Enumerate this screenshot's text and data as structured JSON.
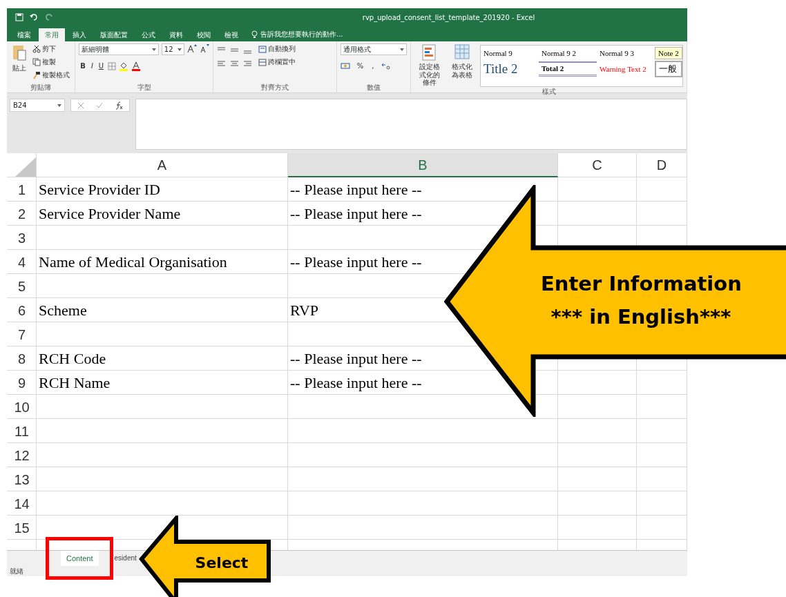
{
  "window": {
    "title": "rvp_upload_consent_list_template_201920 - Excel"
  },
  "ribbon_tabs": [
    {
      "label": "檔案",
      "selected": false
    },
    {
      "label": "常用",
      "selected": true
    },
    {
      "label": "插入",
      "selected": false
    },
    {
      "label": "版面配置",
      "selected": false
    },
    {
      "label": "公式",
      "selected": false
    },
    {
      "label": "資料",
      "selected": false
    },
    {
      "label": "校閱",
      "selected": false
    },
    {
      "label": "檢視",
      "selected": false
    }
  ],
  "tell_me": "告訴我您想要執行的動作...",
  "clipboard": {
    "paste": "貼上",
    "items": [
      "剪下",
      "複製",
      "複製格式"
    ],
    "label": "剪貼簿"
  },
  "font": {
    "name": "新細明體",
    "size": "12",
    "buttons": [
      "B",
      "I",
      "U"
    ],
    "label": "字型"
  },
  "alignment": {
    "items": [
      "自動換列",
      "跨欄置中"
    ],
    "label": "對齊方式"
  },
  "number": {
    "format": "通用格式",
    "symbols": [
      "%",
      ","
    ],
    "label": "數值"
  },
  "styles": {
    "buttons": [
      "設定格式化的條件",
      "格式化為表格"
    ],
    "label": "樣式",
    "gallery": [
      {
        "label": "Normal 9",
        "kind": "normal"
      },
      {
        "label": "Normal 9 2",
        "kind": "normal"
      },
      {
        "label": "Normal 9 3",
        "kind": "normal"
      },
      {
        "label": "Note 2",
        "kind": "note"
      },
      {
        "label": "Title 2",
        "kind": "title"
      },
      {
        "label": "Total 2",
        "kind": "total"
      },
      {
        "label": "Warning Text 2",
        "kind": "warning"
      },
      {
        "label": "一般",
        "kind": "boxed"
      }
    ]
  },
  "formula_bar": {
    "name_box": "B24"
  },
  "sheet": {
    "columns": [
      {
        "label": "A",
        "selected": false
      },
      {
        "label": "B",
        "selected": true
      },
      {
        "label": "C",
        "selected": false
      },
      {
        "label": "D",
        "selected": false
      }
    ],
    "rows": [
      {
        "header": "1",
        "cells": [
          "Service Provider ID",
          "-- Please input here --"
        ]
      },
      {
        "header": "2",
        "cells": [
          "Service Provider Name",
          "-- Please input here --"
        ]
      },
      {
        "header": "3",
        "cells": []
      },
      {
        "header": "4",
        "cells": [
          "Name of Medical Organisation",
          "-- Please input here --"
        ]
      },
      {
        "header": "5",
        "cells": []
      },
      {
        "header": "6",
        "cells": [
          "Scheme",
          "RVP"
        ]
      },
      {
        "header": "7",
        "cells": []
      },
      {
        "header": "8",
        "cells": [
          "RCH Code",
          "-- Please input here --"
        ]
      },
      {
        "header": "9",
        "cells": [
          "RCH Name",
          "-- Please input here --"
        ]
      },
      {
        "header": "10",
        "cells": []
      },
      {
        "header": "11",
        "cells": []
      },
      {
        "header": "12",
        "cells": []
      },
      {
        "header": "13",
        "cells": []
      },
      {
        "header": "14",
        "cells": []
      },
      {
        "header": "15",
        "cells": []
      }
    ]
  },
  "sheet_tabs": [
    {
      "label": "Content",
      "selected": true
    },
    {
      "label": "esident",
      "selected": false
    }
  ],
  "status_bar": "就緒",
  "annotations": [
    {
      "kind": "big-arrow",
      "lines": [
        "Enter Information",
        "*** in English***"
      ]
    },
    {
      "kind": "small-arrow",
      "lines": [
        "Select"
      ]
    },
    {
      "kind": "frame"
    }
  ]
}
